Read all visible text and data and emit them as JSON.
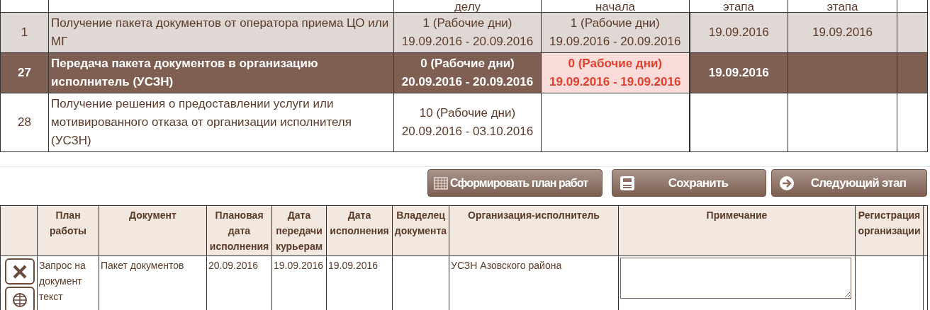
{
  "stage_table": {
    "headers": {
      "column_3": "делу",
      "column_4": "начала",
      "column_5": "этапа",
      "column_6": "этапа"
    },
    "rows": [
      {
        "number": "1",
        "name": "Получение пакета документов от оператора приема ЦО или МГ",
        "kind": "done",
        "duration": [
          "1 (Рабочие дни)",
          "19.09.2016 - 20.09.2016"
        ],
        "planned_start": {
          "lines": [
            "1 (Рабочие дни)",
            "19.09.2016 - 20.09.2016"
          ],
          "overdue": false
        },
        "stage_start": "19.09.2016",
        "stage_end": "19.09.2016"
      },
      {
        "number": "27",
        "name": "Передача пакета документов в организацию исполнитель (УСЗН)",
        "kind": "current",
        "duration": [
          "0 (Рабочие дни)",
          "20.09.2016 - 20.09.2016"
        ],
        "planned_start": {
          "lines": [
            "0 (Рабочие дни)",
            "19.09.2016 - 19.09.2016"
          ],
          "overdue": true
        },
        "stage_start": "19.09.2016"
      },
      {
        "number": "28",
        "name": "Получение решения о предоставлении услуги или мотивированного отказа от организации исполнителя (УСЗН)",
        "kind": "pending",
        "duration": [
          "10 (Рабочие дни)",
          "20.09.2016 - 03.10.2016"
        ]
      }
    ]
  },
  "buttons": [
    {
      "label": "Сформировать план работ",
      "kind": "grid"
    },
    {
      "label": "Сохранить",
      "kind": "save"
    },
    {
      "label": "Следующий этап",
      "kind": "next"
    }
  ],
  "documents_table": {
    "columns": [
      "План работы",
      "Документ",
      "Плановая дата исполнения",
      "Дата передачи курьерам",
      "Дата исполнения",
      "Владелец документа",
      "Организация-исполнитель",
      "Примечание",
      "Регистрация организации"
    ],
    "rows": [
      {
        "plan": "Запрос на документ текст",
        "document": "Пакет документов",
        "planned_date": "20.09.2016",
        "courier_date": "19.09.2016",
        "done_date": "19.09.2016",
        "organization": "УСЗН Азовского района"
      }
    ]
  }
}
